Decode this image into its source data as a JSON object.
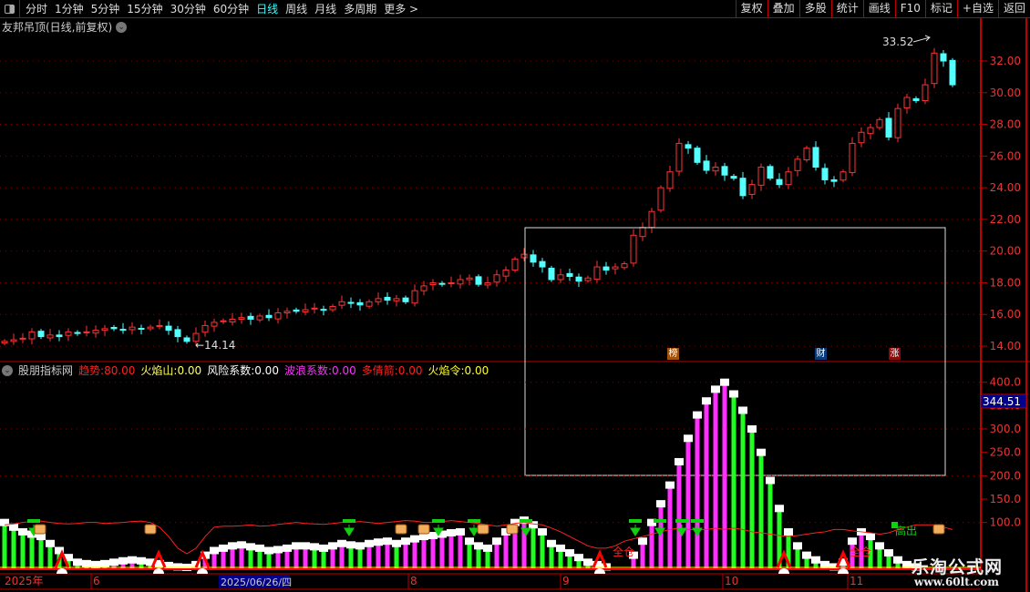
{
  "toolbar": {
    "periods": [
      "分时",
      "1分钟",
      "5分钟",
      "15分钟",
      "30分钟",
      "60分钟",
      "日线",
      "周线",
      "月线",
      "多周期",
      "更多 >"
    ],
    "active": "日线",
    "buttons": [
      "复权",
      "叠加",
      "多股",
      "统计",
      "画线",
      "F10",
      "标记",
      "+自选",
      "返回"
    ]
  },
  "main": {
    "title": "友邦吊顶(日线,前复权)",
    "high_label": "33.52",
    "low_label": "←14.14",
    "price_axis": [
      "32.00",
      "30.00",
      "28.00",
      "26.00",
      "24.00",
      "22.00",
      "20.00",
      "18.00",
      "16.00",
      "14.00"
    ],
    "markers": [
      {
        "text": "榜",
        "color": "#a0520a"
      },
      {
        "text": "财",
        "color": "#0a3a7a"
      },
      {
        "text": "涨",
        "color": "#8a0a0a"
      }
    ],
    "closes": [
      14.3,
      14.4,
      14.5,
      14.9,
      14.6,
      14.7,
      14.6,
      14.9,
      14.8,
      14.9,
      15.0,
      15.1,
      15.1,
      15.0,
      15.2,
      15.1,
      15.2,
      15.3,
      15.0,
      14.6,
      14.3,
      14.8,
      15.3,
      15.5,
      15.6,
      15.7,
      15.8,
      15.7,
      15.9,
      15.8,
      16.1,
      16.2,
      16.2,
      16.3,
      16.4,
      16.3,
      16.5,
      16.8,
      16.7,
      16.6,
      16.8,
      17.0,
      16.9,
      17.0,
      16.8,
      17.5,
      17.8,
      18.0,
      17.9,
      18.0,
      18.2,
      18.3,
      17.9,
      18.0,
      18.5,
      18.8,
      19.5,
      19.8,
      19.3,
      19.0,
      18.2,
      18.5,
      18.4,
      18.1,
      18.3,
      19.0,
      18.8,
      19.0,
      19.2,
      21.0,
      21.5,
      22.5,
      24.0,
      25.0,
      26.8,
      26.5,
      25.6,
      25.1,
      25.3,
      24.8,
      24.6,
      23.5,
      24.2,
      25.3,
      24.6,
      24.2,
      25.0,
      25.8,
      26.5,
      25.3,
      24.5,
      24.4,
      25.0,
      26.8,
      27.5,
      27.8,
      28.3,
      27.2,
      29.0,
      29.7,
      29.5,
      30.5,
      32.5,
      32.0,
      30.5
    ],
    "colors": {
      "up": "#ff3232",
      "down": "#54ffff"
    }
  },
  "indicator": {
    "name": "股朋指标网",
    "values": [
      {
        "label": "趋势:",
        "value": "80.00",
        "color": "#ff2020"
      },
      {
        "label": "火焰山:",
        "value": "0.00",
        "color": "#ffff60"
      },
      {
        "label": "风险系数:",
        "value": "0.00",
        "color": "#ffffff"
      },
      {
        "label": "波浪系数:",
        "value": "0.00",
        "color": "#ff30ff"
      },
      {
        "label": "多倩箭:",
        "value": "0.00",
        "color": "#ff2020"
      },
      {
        "label": "火焰令:",
        "value": "0.00",
        "color": "#ffff30"
      }
    ],
    "axis": [
      "400.0",
      "350.0",
      "300.0",
      "250.0",
      "200.0",
      "150.0",
      "100.0"
    ],
    "current_value": "344.51",
    "bars": [
      100,
      90,
      80,
      75,
      70,
      55,
      40,
      25,
      15,
      12,
      10,
      12,
      15,
      18,
      20,
      18,
      15,
      12,
      8,
      5,
      4,
      10,
      30,
      40,
      45,
      50,
      52,
      48,
      45,
      40,
      42,
      45,
      50,
      50,
      48,
      45,
      50,
      55,
      52,
      50,
      55,
      58,
      60,
      55,
      60,
      65,
      70,
      72,
      75,
      78,
      80,
      60,
      50,
      45,
      60,
      80,
      100,
      105,
      95,
      80,
      55,
      45,
      35,
      25,
      15,
      10,
      5,
      0,
      0,
      30,
      60,
      100,
      140,
      180,
      230,
      280,
      330,
      360,
      385,
      400,
      375,
      340,
      300,
      250,
      190,
      130,
      80,
      50,
      30,
      20,
      10,
      5,
      15,
      60,
      80,
      70,
      50,
      35,
      20,
      10,
      5,
      0,
      0,
      0,
      0
    ],
    "line": [
      95,
      97,
      100,
      102,
      103,
      100,
      98,
      97,
      98,
      100,
      100,
      98,
      99,
      100,
      102,
      103,
      100,
      90,
      70,
      45,
      33,
      45,
      70,
      90,
      92,
      92,
      93,
      95,
      92,
      93,
      96,
      98,
      100,
      98,
      97,
      96,
      98,
      100,
      100,
      102,
      100,
      98,
      100,
      102,
      104,
      103,
      100,
      100,
      102,
      104,
      102,
      100,
      98,
      95,
      92,
      95,
      98,
      100,
      97,
      95,
      88,
      80,
      70,
      60,
      50,
      45,
      45,
      50,
      60,
      65,
      70,
      75,
      80,
      85,
      88,
      85,
      85,
      85,
      88,
      85,
      88,
      85,
      80,
      78,
      75,
      72,
      70,
      72,
      75,
      78,
      80,
      85,
      85,
      82,
      80,
      78,
      75,
      78,
      85,
      90,
      95,
      95,
      95,
      90,
      85
    ],
    "labels": {
      "full": "全仓",
      "sell": "高出"
    },
    "colors": {
      "rise": "#ff30ff",
      "fall": "#20ff20",
      "line": "#ff2020"
    }
  },
  "date_axis": {
    "year": "2025年",
    "months": [
      "6",
      "8",
      "9",
      "10",
      "11"
    ],
    "cursor_date": "2025/06/26/四"
  },
  "watermark": {
    "name": "乐淘公式网",
    "url": "www.60lt.com"
  }
}
